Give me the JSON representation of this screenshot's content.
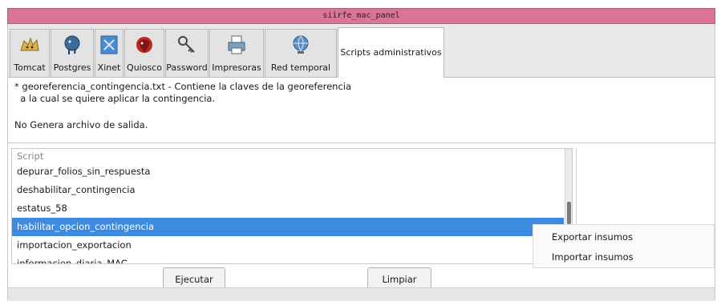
{
  "window": {
    "title": "siirfe_mac_panel"
  },
  "tabs": [
    {
      "label": "Tomcat",
      "icon": "tomcat-icon"
    },
    {
      "label": "Postgres",
      "icon": "postgres-elephant-icon"
    },
    {
      "label": "Xinet",
      "icon": "xinet-icon"
    },
    {
      "label": "Quiosco",
      "icon": "quiosco-icon"
    },
    {
      "label": "Password",
      "icon": "key-icon"
    },
    {
      "label": "Impresoras",
      "icon": "printer-icon"
    },
    {
      "label": "Red temporal",
      "icon": "network-globe-icon"
    },
    {
      "label": "Scripts administrativos",
      "icon": ""
    }
  ],
  "description": {
    "line1": "* georeferencia_contingencia.txt - Contiene la claves de la georeferencia",
    "line2": "  a la cual se quiere aplicar la contingencia.",
    "no_output": "No Genera archivo de salida."
  },
  "script_list": {
    "header": "Script",
    "items": [
      "depurar_folios_sin_respuesta",
      "deshabilitar_contingencia",
      "estatus_58",
      "habilitar_opcion_contingencia",
      "importacion_exportacion",
      "informacion_diaria_MAC"
    ],
    "selected_index": 3
  },
  "context_menu": {
    "items": [
      "Exportar insumos",
      "Importar insumos"
    ]
  },
  "buttons": {
    "execute": "Ejecutar",
    "clear": "Limpiar"
  },
  "colors": {
    "titlebar": "#d97598",
    "selection": "#3d8be0"
  }
}
